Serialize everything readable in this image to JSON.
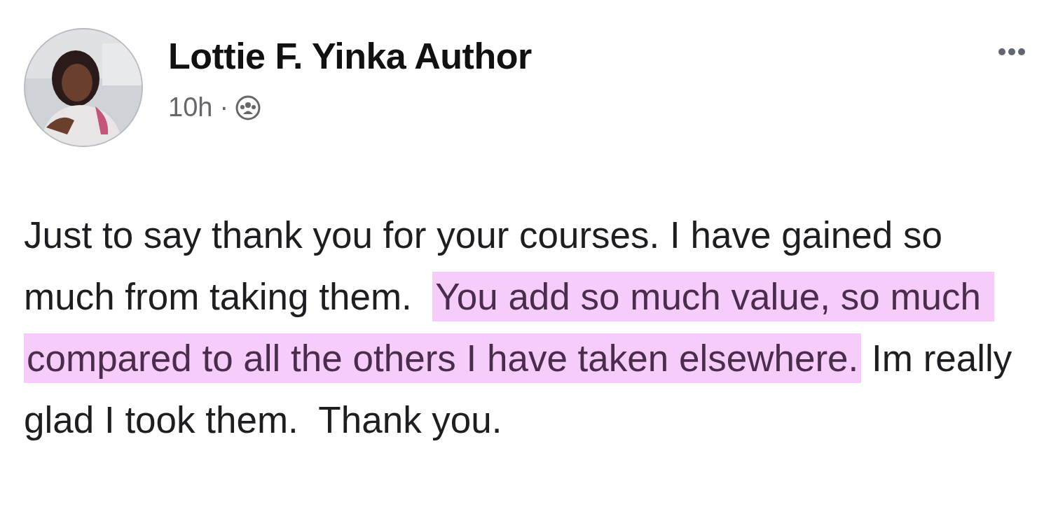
{
  "post": {
    "author": "Lottie F. Yinka Author",
    "time": "10h",
    "separator": "·",
    "body": [
      {
        "text": "Just to say thank you for your courses. I have gained so much from taking them.  ",
        "highlighted": false
      },
      {
        "text": "You add so much value, so much compared to all the others I have taken elsewhere.",
        "highlighted": true
      },
      {
        "text": " Im really glad I took them.  Thank you.",
        "highlighted": false
      }
    ]
  }
}
